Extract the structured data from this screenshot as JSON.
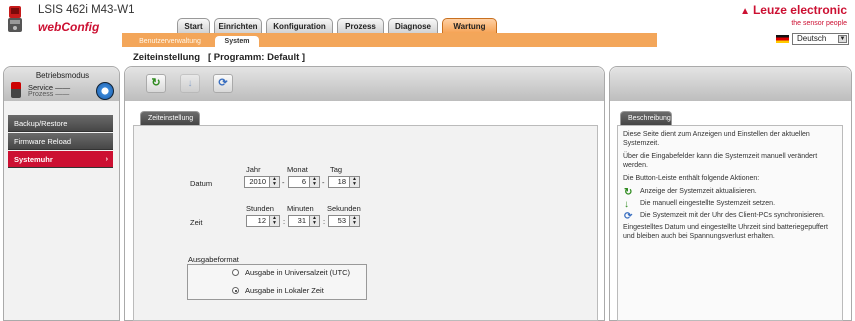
{
  "header": {
    "product": "LSIS 462i M43-W1",
    "app_name": "webConfig",
    "brand": "Leuze electronic",
    "slogan": "the sensor people",
    "brand_color": "#cc1032",
    "device_icon": "sensor-device-icon"
  },
  "nav": {
    "tabs": [
      {
        "label": "Start"
      },
      {
        "label": "Einrichten"
      },
      {
        "label": "Konfiguration"
      },
      {
        "label": "Prozess"
      },
      {
        "label": "Diagnose"
      },
      {
        "label": "Wartung",
        "active": true
      }
    ],
    "subtabs": [
      {
        "label": "Benutzerverwaltung"
      },
      {
        "label": "System",
        "active": true
      }
    ],
    "accent_color": "#f3a65a"
  },
  "language": {
    "selected": "Deutsch"
  },
  "page": {
    "title": "Zeiteinstellung",
    "program": "[ Programm: Default ]"
  },
  "mode": {
    "title": "Betriebsmodus",
    "service": "Service",
    "prozess": "Prozess"
  },
  "sidebar": {
    "items": [
      {
        "label": "Backup/Restore"
      },
      {
        "label": "Firmware Reload"
      },
      {
        "label": "Systemuhr",
        "selected": true,
        "arrow": "›"
      }
    ]
  },
  "toolbar": {
    "refresh_icon": "refresh-icon",
    "set_icon": "set-time-icon",
    "sync_icon": "sync-pc-time-icon",
    "refresh_glyph": "↻",
    "set_glyph": "↓",
    "sync_glyph": "⟳"
  },
  "settings": {
    "tab_label": "Zeiteinstellung",
    "date": {
      "label": "Datum",
      "headers": [
        "Jahr",
        "Monat",
        "Tag"
      ],
      "values": [
        "2010",
        "6",
        "18"
      ]
    },
    "time": {
      "label": "Zeit",
      "headers": [
        "Stunden",
        "Minuten",
        "Sekunden"
      ],
      "values": [
        "12",
        "31",
        "53"
      ]
    },
    "date_sep": "-",
    "time_sep": ":",
    "format": {
      "legend": "Ausgabeformat",
      "options": [
        {
          "label": "Ausgabe in Universalzeit (UTC)",
          "checked": false
        },
        {
          "label": "Ausgabe in Lokaler Zeit",
          "checked": true
        }
      ]
    }
  },
  "description": {
    "tab_label": "Beschreibung",
    "p1": "Diese Seite dient zum Anzeigen und Einstellen der aktuellen Systemzeit.",
    "p2": "Über die Eingabefelder kann die Systemzeit manuell verändert werden.",
    "p3": "Die Button-Leiste enthält folgende Aktionen:",
    "actions": [
      "Anzeige der Systemzeit aktualisieren.",
      "Die manuell eingestellte Systemzeit setzen.",
      "Die Systemzeit mit der Uhr des Client-PCs synchronisieren."
    ],
    "p4": "Eingestelltes Datum und eingestellte Uhrzeit sind batteriegepuffert und bleiben auch bei Spannungsverlust erhalten."
  }
}
